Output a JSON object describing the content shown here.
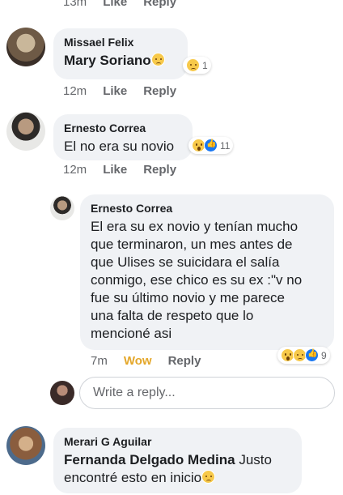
{
  "top_meta": {
    "time": "13m",
    "like": "Like",
    "reply": "Reply"
  },
  "comments": [
    {
      "author": "Missael Felix",
      "tag": "Mary Soriano",
      "text": "",
      "reaction_count": "1",
      "time": "12m",
      "like": "Like",
      "reply": "Reply"
    },
    {
      "author": "Ernesto Correa",
      "text": "El no era su novio",
      "reaction_count": "11",
      "time": "12m",
      "like": "Like",
      "reply": "Reply"
    },
    {
      "author": "Ernesto Correa",
      "text_lines": [
        "El era su ex novio y tenían mucho",
        "que terminaron, un mes antes de",
        "que Ulises se suicidara el salía",
        "conmigo, ese chico es su ex :\"v no",
        "fue su último novio y me parece",
        "una falta de respeto que lo",
        "mencioné asi"
      ],
      "reaction_count": "9",
      "time": "7m",
      "like": "Wow",
      "reply": "Reply"
    },
    {
      "author": "Merari G Aguilar",
      "tag": "Fernanda Delgado Medina",
      "text": " Justo",
      "text_line2": "encontré esto en inicio"
    }
  ],
  "reply_input": {
    "placeholder": "Write a reply..."
  },
  "colors": {
    "bubble": "#f0f2f5",
    "wow": "#e4a72a",
    "like_blue": "#1877f2",
    "meta_gray": "#65676b"
  }
}
